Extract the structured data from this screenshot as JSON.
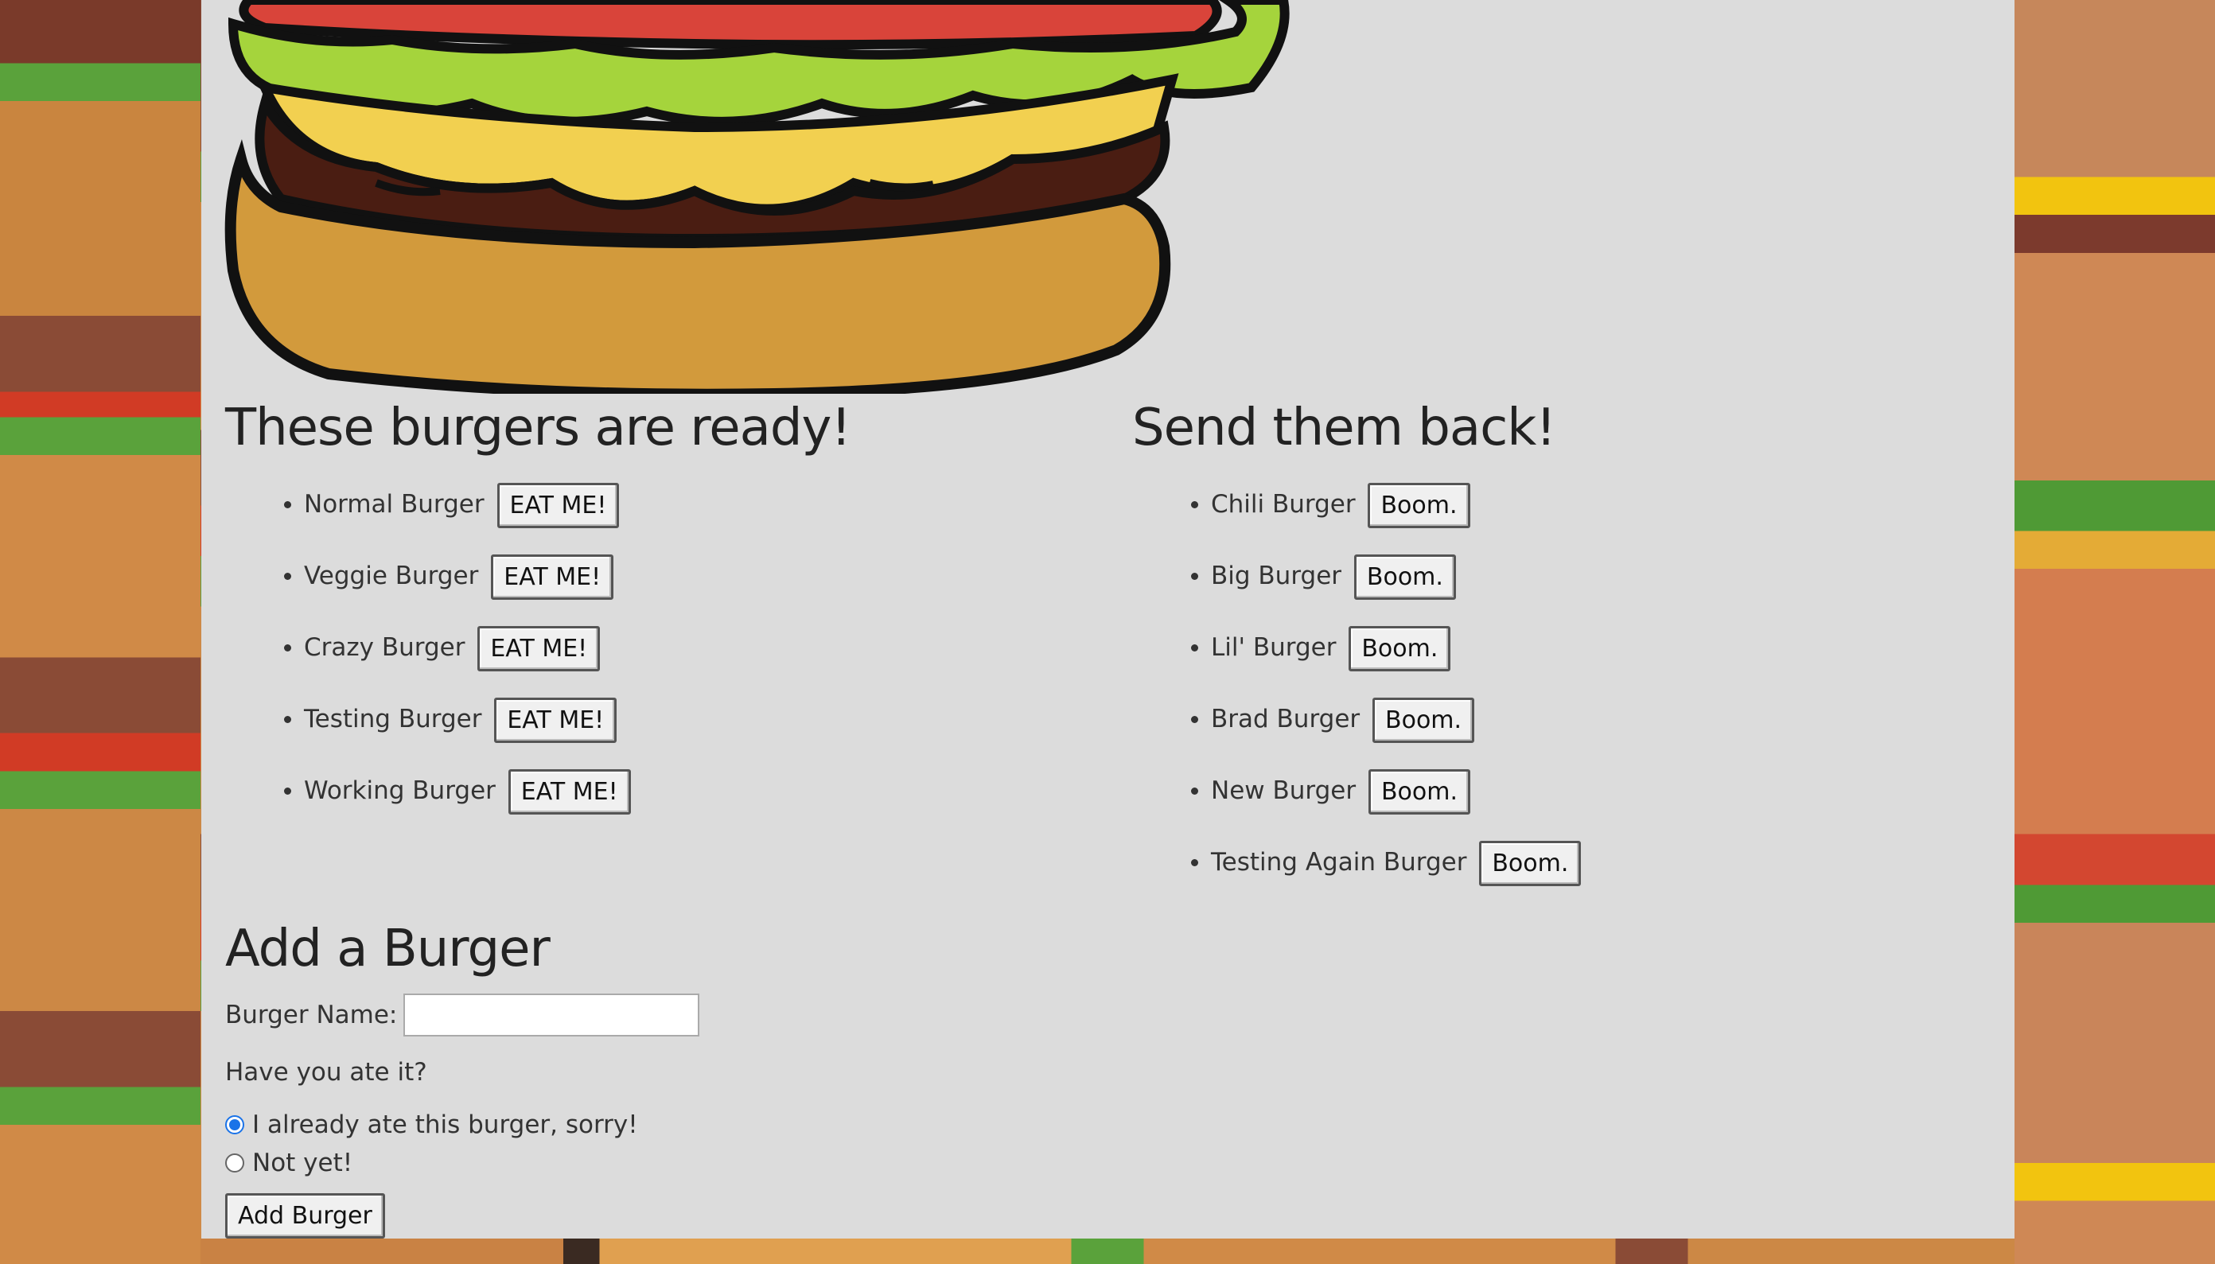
{
  "colors": {
    "panel_bg": "#dcdcdc",
    "radio_accent": "#1a73e8"
  },
  "ready": {
    "heading": "These burgers are ready!",
    "items": [
      {
        "name": "Normal Burger",
        "button": "EAT ME!"
      },
      {
        "name": "Veggie Burger",
        "button": "EAT ME!"
      },
      {
        "name": "Crazy Burger",
        "button": "EAT ME!"
      },
      {
        "name": "Testing Burger",
        "button": "EAT ME!"
      },
      {
        "name": "Working Burger",
        "button": "EAT ME!"
      }
    ]
  },
  "eaten": {
    "heading": "Send them back!",
    "items": [
      {
        "name": "Chili Burger",
        "button": "Boom."
      },
      {
        "name": "Big Burger",
        "button": "Boom."
      },
      {
        "name": "Lil' Burger",
        "button": "Boom."
      },
      {
        "name": "Brad Burger",
        "button": "Boom."
      },
      {
        "name": "New Burger",
        "button": "Boom."
      },
      {
        "name": "Testing Again Burger",
        "button": "Boom."
      }
    ]
  },
  "form": {
    "heading": "Add a Burger",
    "name_label": "Burger Name:",
    "name_value": "",
    "question": "Have you ate it?",
    "option_yes": "I already ate this burger, sorry!",
    "option_no": "Not yet!",
    "selected": "yes",
    "submit_label": "Add Burger"
  }
}
